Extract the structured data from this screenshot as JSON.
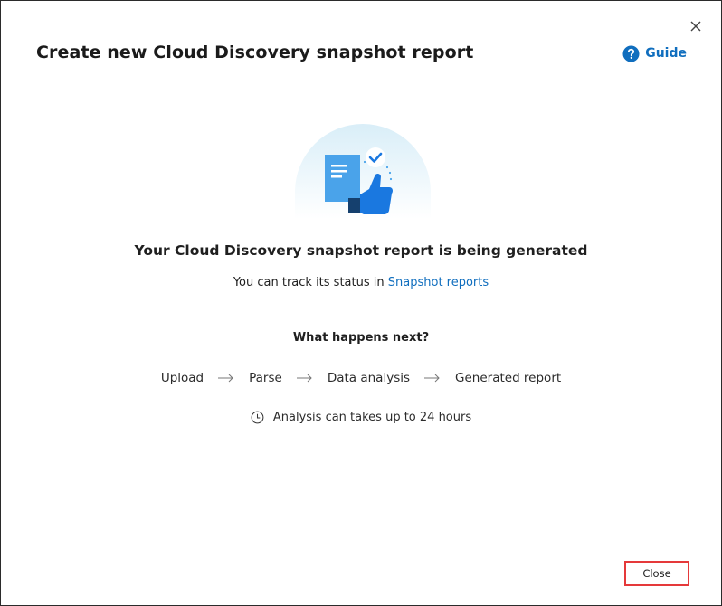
{
  "dialog": {
    "title": "Create new Cloud Discovery snapshot report",
    "guide_label": "Guide",
    "close_icon": "close-icon",
    "guide_icon": "help-circle-icon"
  },
  "main": {
    "status_heading": "Your Cloud Discovery snapshot report is being generated",
    "track_prefix": "You can track its status in",
    "track_link": "Snapshot reports",
    "next_heading": "What happens next?",
    "steps": [
      "Upload",
      "Parse",
      "Data analysis",
      "Generated report"
    ],
    "time_note": "Analysis can takes up to 24 hours",
    "illustration": "report-thumbs-up-illustration"
  },
  "footer": {
    "close_label": "Close"
  },
  "colors": {
    "accent": "#106ebe",
    "highlight_border": "#e5393a"
  }
}
